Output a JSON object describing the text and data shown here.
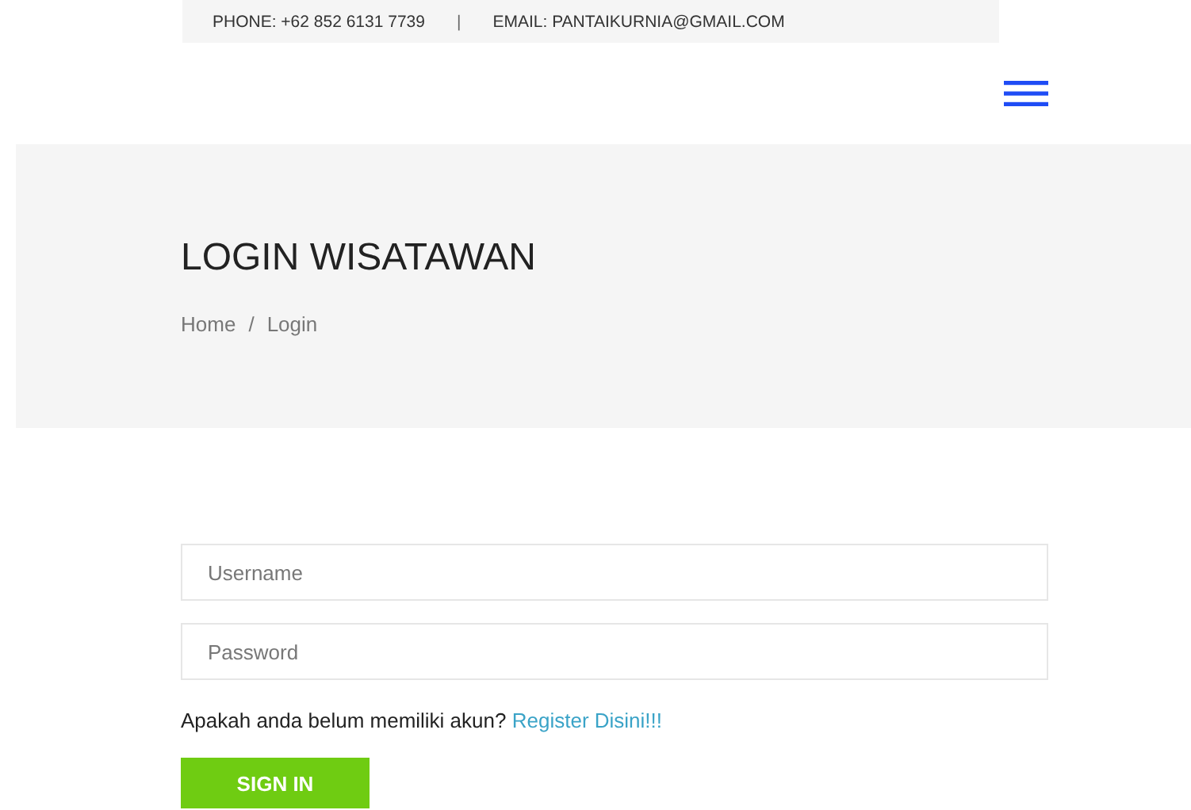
{
  "top_bar": {
    "phone": "PHONE: +62 852 6131 7739",
    "separator": "|",
    "email": "EMAIL: PANTAIKURNIA@GMAIL.COM"
  },
  "banner": {
    "title": "LOGIN WISATAWAN",
    "breadcrumb": [
      {
        "label": "Home"
      },
      {
        "label": "/"
      },
      {
        "label": "Login"
      }
    ]
  },
  "form": {
    "fields": [
      {
        "placeholder": "Username"
      },
      {
        "placeholder": "Password"
      }
    ],
    "register_prompt": "Apakah anda belum memiliki akun?",
    "register_link": "Register Disini!!!",
    "submit": "SIGN IN"
  }
}
